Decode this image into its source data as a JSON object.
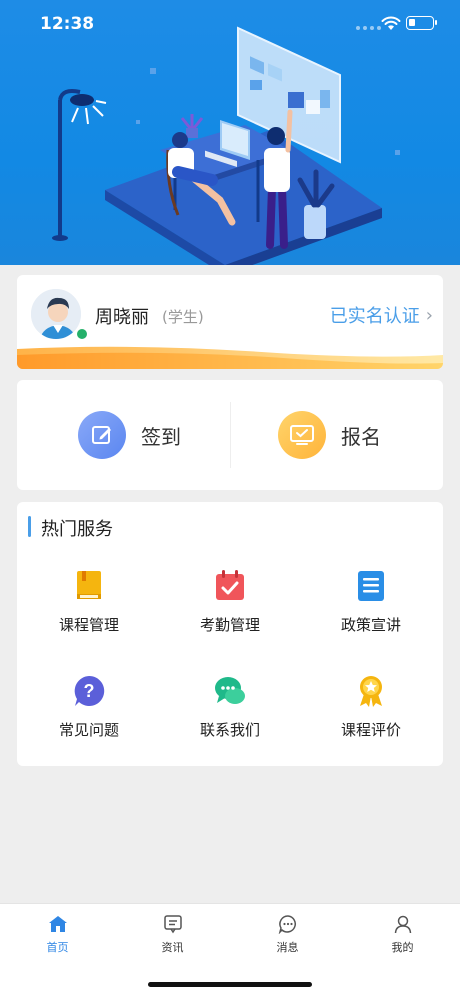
{
  "status_bar": {
    "time": "12:38"
  },
  "profile": {
    "name": "周晓丽",
    "role": "(学生)",
    "verify_text": "已实名认证",
    "chevron": "›"
  },
  "actions": [
    {
      "label": "签到",
      "icon": "edit-icon",
      "color": "#6b93f3"
    },
    {
      "label": "报名",
      "icon": "screen-icon",
      "color": "#ffbf47"
    }
  ],
  "services": {
    "title": "热门服务",
    "items": [
      {
        "label": "课程管理",
        "icon": "book-icon",
        "color": "#f5b50f"
      },
      {
        "label": "考勤管理",
        "icon": "calendar-check-icon",
        "color": "#f0555a"
      },
      {
        "label": "政策宣讲",
        "icon": "document-icon",
        "color": "#2a8ee6"
      },
      {
        "label": "常见问题",
        "icon": "question-icon",
        "color": "#5b5fd9"
      },
      {
        "label": "联系我们",
        "icon": "chat-icon",
        "color": "#1fb98a"
      },
      {
        "label": "课程评价",
        "icon": "medal-icon",
        "color": "#f5b50f"
      }
    ]
  },
  "tabbar": {
    "active_color": "#2f86e4",
    "items": [
      {
        "label": "首页",
        "icon": "home-icon"
      },
      {
        "label": "资讯",
        "icon": "news-icon"
      },
      {
        "label": "消息",
        "icon": "message-icon"
      },
      {
        "label": "我的",
        "icon": "user-icon"
      }
    ]
  }
}
